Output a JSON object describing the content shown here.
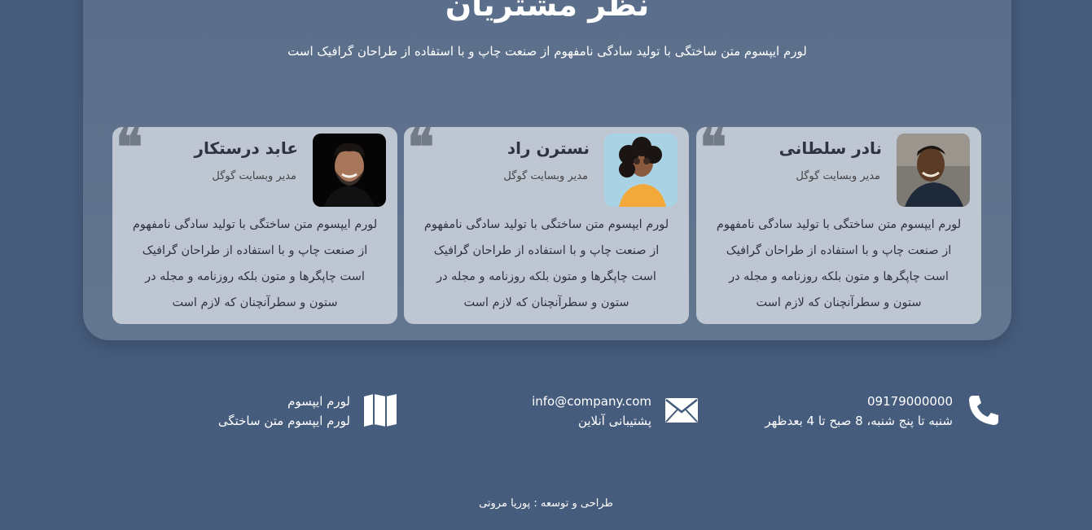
{
  "section": {
    "title": "نظر مشتریان",
    "subtitle": "لورم ایپسوم متن ساختگی با تولید سادگی نامفهوم از صنعت چاپ و با استفاده از طراحان گرافیک است"
  },
  "testimonials": [
    {
      "name": "نادر سلطانی",
      "role": "مدیر وبسایت گوگل",
      "quote_mark": "❝",
      "text": "لورم ایپسوم متن ساختگی با تولید سادگی نامفهوم از صنعت چاپ و با استفاده از طراحان گرافیک است چاپگرها و متون بلکه روزنامه و مجله در ستون و سطرآنچنان که لازم است"
    },
    {
      "name": "نسترن راد",
      "role": "مدیر وبسایت گوگل",
      "quote_mark": "❝",
      "text": "لورم ایپسوم متن ساختگی با تولید سادگی نامفهوم از صنعت چاپ و با استفاده از طراحان گرافیک است چاپگرها و متون بلکه روزنامه و مجله در ستون و سطرآنچنان که لازم است"
    },
    {
      "name": "عابد درستکار",
      "role": "مدیر وبسایت گوگل",
      "quote_mark": "❝",
      "text": "لورم ایپسوم متن ساختگی با تولید سادگی نامفهوم از صنعت چاپ و با استفاده از طراحان گرافیک است چاپگرها و متون بلکه روزنامه و مجله در ستون و سطرآنچنان که لازم است"
    }
  ],
  "contacts": {
    "phone": {
      "number": "09179000000",
      "hours": "شنبه تا پنج شنبه، 8 صبح تا 4 بعدظهر",
      "icon": "phone-icon"
    },
    "email": {
      "address": "info@company.com",
      "label": "پشتیبانی آنلاین",
      "icon": "mail-icon"
    },
    "address": {
      "line1": "لورم ایپسوم",
      "line2": "لورم ایپسوم متن ساختگی",
      "icon": "map-icon"
    }
  },
  "footer": {
    "credit": "طراحی و توسعه : پوریا مروتی"
  },
  "colors": {
    "background": "#465c7d",
    "panel": "#5a6e8b",
    "card": "#bec6d2",
    "text_dark": "#2f3340"
  }
}
